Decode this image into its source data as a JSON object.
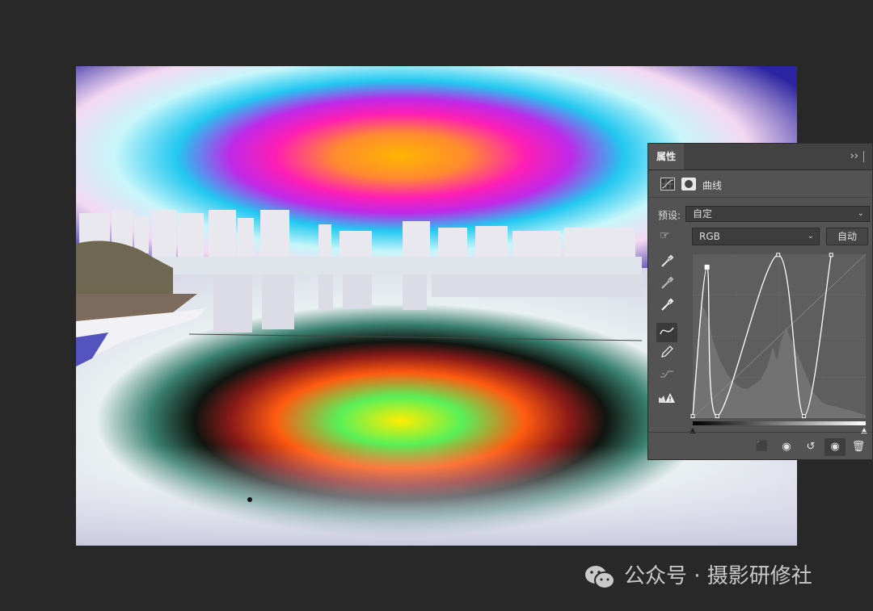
{
  "panel": {
    "tab_title": "属性",
    "menu_icon": "double-chevron-right",
    "adjustment_type_label": "曲线",
    "preset_label": "预设:",
    "preset_value": "自定",
    "channel_value": "RGB",
    "auto_button_label": "自动",
    "tools": [
      "hand-target-icon",
      "black-eyedropper-icon",
      "gray-eyedropper-icon",
      "white-eyedropper-icon",
      "curve-tool-icon",
      "pencil-icon",
      "smooth-icon",
      "clipping-warning-icon"
    ],
    "footer_icons": [
      "clip-to-layer-icon",
      "previous-state-icon",
      "reset-icon",
      "visibility-eye-icon",
      "trash-icon"
    ]
  },
  "curve_points": [
    {
      "input": 0,
      "output": 3
    },
    {
      "input": 21,
      "output": 235
    },
    {
      "input": 36,
      "output": 3
    },
    {
      "input": 126,
      "output": 254
    },
    {
      "input": 164,
      "output": 3
    },
    {
      "input": 204,
      "output": 254
    }
  ],
  "watermark": {
    "text": "公众号 · 摄影研修社"
  },
  "colors": {
    "canvas_background": "#282828",
    "panel_background": "#535353",
    "histogram": "#727272",
    "curve": "#ffffff"
  }
}
